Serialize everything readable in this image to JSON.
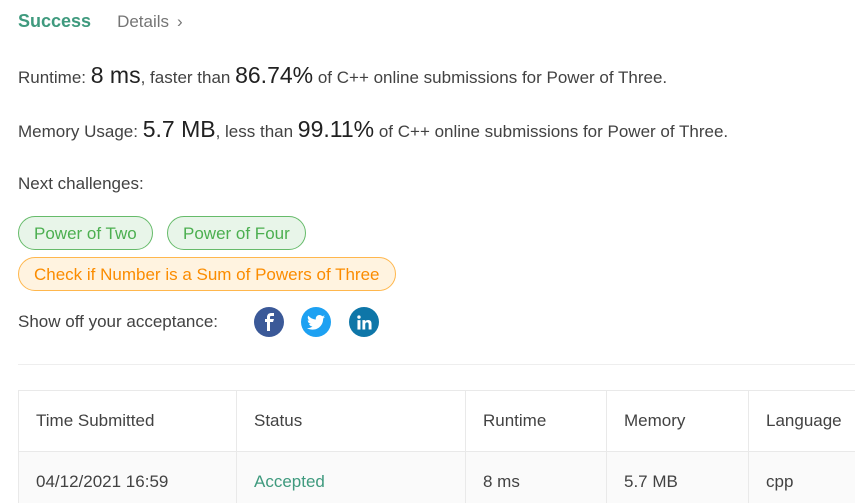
{
  "header": {
    "status": "Success",
    "details_label": "Details",
    "chevron": "›"
  },
  "runtime": {
    "label": "Runtime: ",
    "value": "8 ms",
    "comparison": ", faster than ",
    "percent": "86.74%",
    "suffix": " of C++ online submissions for Power of Three."
  },
  "memory": {
    "label": "Memory Usage: ",
    "value": "5.7 MB",
    "comparison": ", less than ",
    "percent": "99.11%",
    "suffix": " of C++ online submissions for Power of Three."
  },
  "next_challenges": {
    "label": "Next challenges:",
    "items": [
      {
        "title": "Power of Two",
        "difficulty": "easy"
      },
      {
        "title": "Power of Four",
        "difficulty": "easy"
      },
      {
        "title": "Check if Number is a Sum of Powers of Three",
        "difficulty": "medium"
      }
    ]
  },
  "share": {
    "label": "Show off your acceptance:",
    "icons": [
      {
        "name": "facebook-icon",
        "glyph": "f",
        "color": "#3b5998"
      },
      {
        "name": "twitter-icon",
        "glyph": "🐦",
        "color": "#1da1f2"
      },
      {
        "name": "linkedin-icon",
        "glyph": "in",
        "color": "#0e76a8"
      }
    ]
  },
  "table": {
    "headers": [
      "Time Submitted",
      "Status",
      "Runtime",
      "Memory",
      "Language"
    ],
    "rows": [
      {
        "time": "04/12/2021 16:59",
        "status": "Accepted",
        "runtime": "8 ms",
        "memory": "5.7 MB",
        "language": "cpp"
      }
    ]
  },
  "colors": {
    "success": "#3f9a7e",
    "easy": "#4caf50",
    "medium": "#fb8c00"
  }
}
